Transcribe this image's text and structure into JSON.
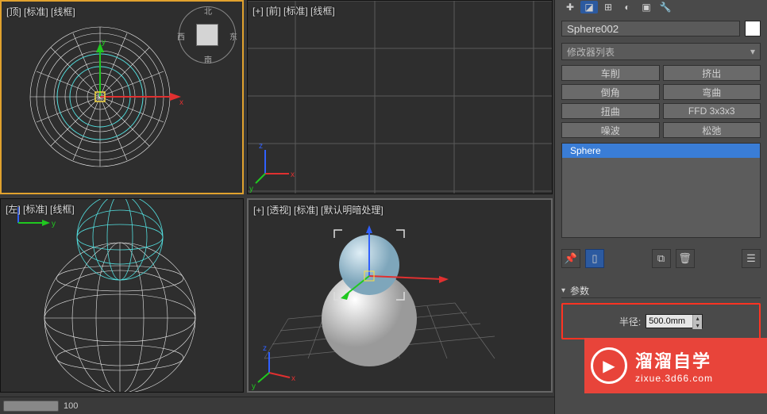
{
  "viewports": {
    "top": {
      "label": "[顶] [标准] [线框]"
    },
    "front": {
      "label": "[+] [前] [标准] [线框]"
    },
    "left": {
      "label": "[左] [标准] [线框]"
    },
    "persp": {
      "label": "[+] [透视] [标准] [默认明暗处理]"
    }
  },
  "viewcube": {
    "n": "北",
    "s": "南",
    "e": "东",
    "w": "西"
  },
  "panel": {
    "object_name": "Sphere002",
    "modifier_list_label": "修改器列表",
    "mod_buttons": [
      "车削",
      "挤出",
      "倒角",
      "弯曲",
      "扭曲",
      "FFD 3x3x3",
      "噪波",
      "松弛"
    ],
    "stack_item": "Sphere",
    "rollout_title": "参数",
    "radius_label": "半径:",
    "radius_value": "500.0mm"
  },
  "timeline": {
    "frame": "100"
  },
  "watermark": {
    "title": "溜溜自学",
    "url": "zixue.3d66.com"
  }
}
